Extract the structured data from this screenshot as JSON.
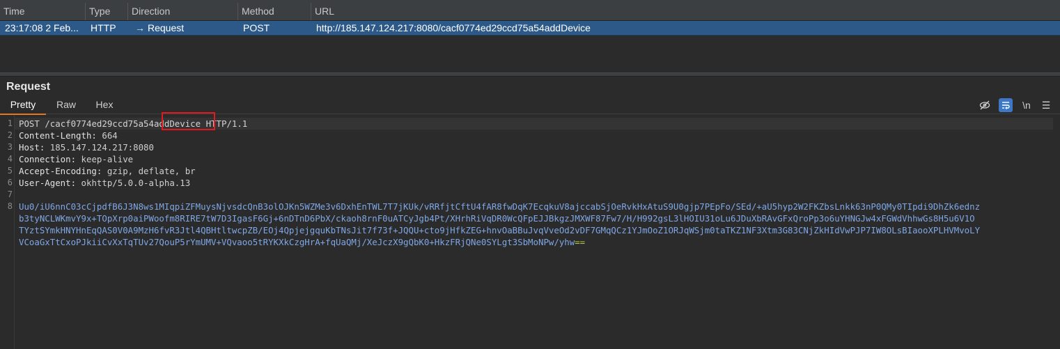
{
  "table": {
    "columns": [
      "Time",
      "Type",
      "Direction",
      "Method",
      "URL"
    ],
    "row": {
      "time": "23:17:08 2 Feb...",
      "type": "HTTP",
      "direction": "Request",
      "method": "POST",
      "url": "http://185.147.124.217:8080/cacf0774ed29ccd75a54addDevice"
    }
  },
  "panel": {
    "title": "Request",
    "tabs": [
      "Pretty",
      "Raw",
      "Hex"
    ],
    "active_tab": "Pretty",
    "tools": {
      "newline_label": "\\n"
    }
  },
  "editor": {
    "line_numbers": [
      "1",
      "2",
      "3",
      "4",
      "5",
      "6",
      "7",
      "8"
    ],
    "request_line": {
      "method": "POST",
      "path_prefix": "/cacf0774ed29ccd75a54",
      "path_highlight": "addDevice",
      "version": "HTTP/1.1"
    },
    "headers": [
      {
        "name": "Content-Length:",
        "value": "664"
      },
      {
        "name": "Host:",
        "value": "185.147.124.217:8080"
      },
      {
        "name": "Connection:",
        "value": "keep-alive"
      },
      {
        "name": "Accept-Encoding:",
        "value": "gzip, deflate, br"
      },
      {
        "name": "User-Agent:",
        "value": "okhttp/5.0.0-alpha.13"
      }
    ],
    "body_lines": [
      "Uu0/iU6nnC03cCjpdfB6J3N8ws1MIqpiZFMuysNjvsdcQnB3olOJKn5WZMe3v6DxhEnTWL7T7jKUk/vRRfjtCftU4fAR8fwDqK7EcqkuV8ajccabSjOeRvkHxAtuS9U0gjp7PEpFo/SEd/+aU5hyp2W2FKZbsLnkk63nP0QMy0TIpdi9DhZk6ednz",
      "b3tyNCLWKmvY9x+TOpXrp0aiPWoofm8RIRE7tW7D3IgasF6Gj+6nDTnD6PbX/ckaoh8rnF0uATCyJgb4Pt/XHrhRiVqDR0WcQFpEJJBkgzJMXWF87Fw7/H/H992gsL3lHOIU31oLu6JDuXbRAvGFxQroPp3o6uYHNGJw4xFGWdVhhwGs8H5u6V1O",
      "TYztSYmkHNYHnEqQAS0V0A9MzH6fvR3Jtl4QBHtltwcpZB/EOj4QpjejgquKbTNsJit7f73f+JQQU+cto9jHfkZEG+hnvOaBBuJvqVveOd2vDF7GMqQCz1YJmOoZ1ORJqWSjm0taTKZ1NF3Xtm3G83CNjZkHIdVwPJP7IW8OLsBIaooXPLHVMvoLY",
      "VCoaGxTtCxoPJkiiCvXxTqTUv27QouP5rYmUMV+VQvaoo5tRYKXkCzgHrA+fqUaQMj/XeJczX9gQbK0+HkzFRjQNe0SYLgt3SbMoNPw/yhw"
    ],
    "body_padding": "=="
  },
  "colors": {
    "selected_row": "#2d5988",
    "active_tab_underline": "#e0782a",
    "highlight_box": "#e3191f",
    "body_text": "#7fa7e6"
  }
}
